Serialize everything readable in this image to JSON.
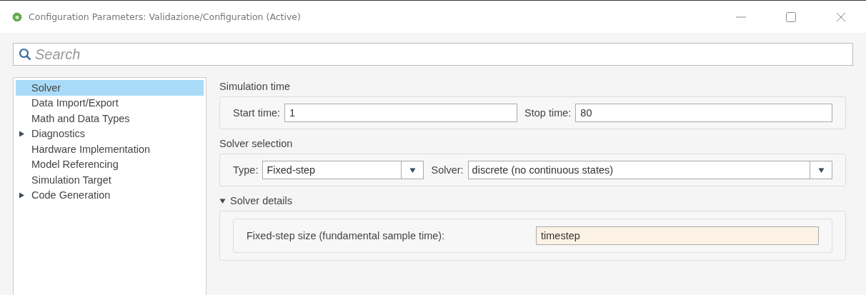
{
  "window": {
    "title": "Configuration Parameters: Validazione/Configuration (Active)"
  },
  "search": {
    "placeholder": "Search"
  },
  "tree": [
    {
      "label": "Solver",
      "selected": true,
      "kind": "page"
    },
    {
      "label": "Data Import/Export",
      "selected": false,
      "kind": "page"
    },
    {
      "label": "Math and Data Types",
      "selected": false,
      "kind": "page"
    },
    {
      "label": "Diagnostics",
      "selected": false,
      "kind": "group",
      "expanded": false
    },
    {
      "label": "Hardware Implementation",
      "selected": false,
      "kind": "page"
    },
    {
      "label": "Model Referencing",
      "selected": false,
      "kind": "page"
    },
    {
      "label": "Simulation Target",
      "selected": false,
      "kind": "page"
    },
    {
      "label": "Code Generation",
      "selected": false,
      "kind": "group",
      "expanded": false
    }
  ],
  "simulation_time": {
    "title": "Simulation time",
    "start_label": "Start time:",
    "start_value": "1",
    "stop_label": "Stop time:",
    "stop_value": "80"
  },
  "solver_selection": {
    "title": "Solver selection",
    "type_label": "Type:",
    "type_value": "Fixed-step",
    "solver_label": "Solver:",
    "solver_value": "discrete (no continuous states)"
  },
  "solver_details": {
    "title": "Solver details",
    "expanded": true,
    "step_label": "Fixed-step size (fundamental sample time):",
    "step_value": "timestep"
  }
}
